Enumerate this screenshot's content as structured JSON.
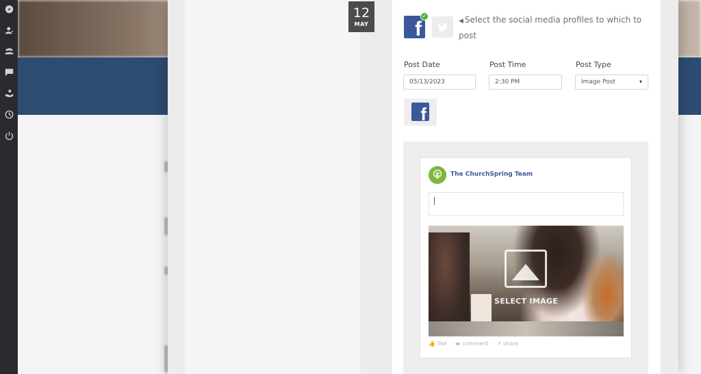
{
  "modal": {
    "date": {
      "day": "12",
      "month": "MAY"
    },
    "instruction": "Select the social media profiles to which to post",
    "fields": {
      "post_date": {
        "label": "Post Date",
        "value": "05/13/2023"
      },
      "post_time": {
        "label": "Post Time",
        "value": "2:30 PM"
      },
      "post_type": {
        "label": "Post Type",
        "value": "Image Post"
      }
    },
    "preview": {
      "page_name": "The ChurchSpring Team",
      "select_image_label": "SELECT IMAGE",
      "actions": {
        "like": "like",
        "comment": "comment",
        "share": "share"
      }
    }
  },
  "colors": {
    "facebook": "#3b5998",
    "sidebar": "#2a2b2e",
    "band": "#2d4c71",
    "avatar": "#7cb63a",
    "check": "#4caf50"
  },
  "icons": [
    "compass-icon",
    "user-icon",
    "group-icon",
    "chat-icon",
    "donate-icon",
    "clock-icon",
    "power-icon",
    "facebook-icon",
    "twitter-icon",
    "church-tree-icon",
    "image-placeholder-icon"
  ]
}
